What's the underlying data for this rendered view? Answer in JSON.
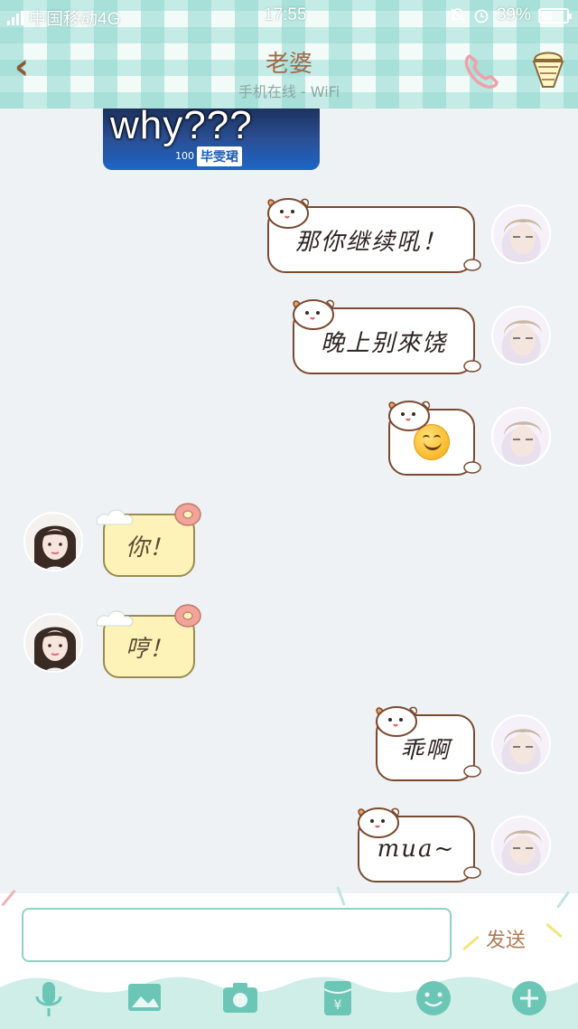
{
  "status_bar": {
    "carrier": "中国移动4G",
    "time": "17:55",
    "battery": "39%"
  },
  "header": {
    "back_icon": "chevron-left-icon",
    "title": "老婆",
    "subtitle": "手机在线 - WiFi",
    "call_icon": "phone-icon",
    "profile_icon": "ice-cream-icon"
  },
  "chat": {
    "image_message": {
      "overlay_text": "why???",
      "caption": "毕雯珺",
      "jersey_number": "100"
    },
    "messages": [
      {
        "sender": "me",
        "text": "那你继续吼！"
      },
      {
        "sender": "me",
        "text": "晚上别來饶"
      },
      {
        "sender": "me",
        "text": "",
        "emoji": "smiling-face"
      },
      {
        "sender": "her",
        "text": "你！"
      },
      {
        "sender": "her",
        "text": "哼！"
      },
      {
        "sender": "me",
        "text": "乖啊"
      },
      {
        "sender": "me",
        "text": "mua~"
      }
    ]
  },
  "composer": {
    "input_value": "",
    "send_label": "发送"
  },
  "toolbar": {
    "icons": [
      "microphone-icon",
      "image-icon",
      "camera-icon",
      "red-packet-icon",
      "emoji-icon",
      "plus-icon"
    ]
  },
  "colors": {
    "plaid": "#8cd7cd",
    "title": "#a06a4a",
    "bubble_border": "#7a4a30",
    "her_bubble": "#fdf3b8",
    "accent_teal": "#6cc6b6"
  }
}
